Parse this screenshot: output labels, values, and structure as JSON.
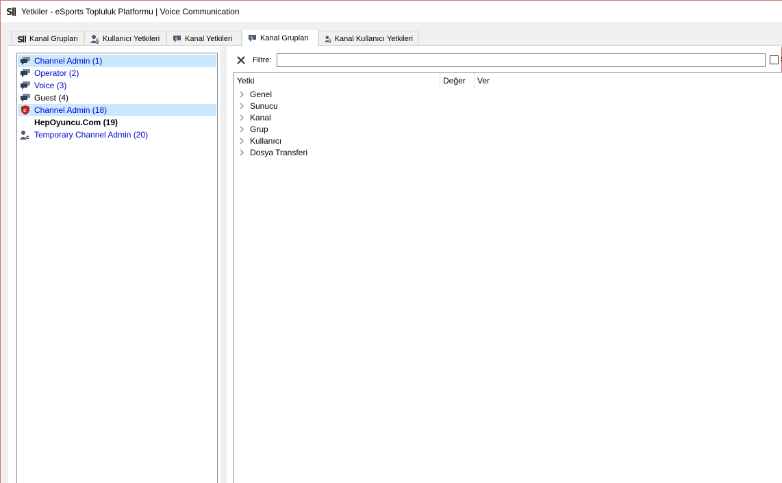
{
  "window": {
    "title": "Yetkiler - eSports Topluluk Platformu | Voice Communication",
    "icon": "permissions-app-icon"
  },
  "tabs": [
    {
      "label": "Kanal Grupları",
      "icon": "server-group-icon",
      "active": false
    },
    {
      "label": "Kullanıcı Yetkileri",
      "icon": "user-permissions-icon",
      "active": false
    },
    {
      "label": "Kanal Yetkileri",
      "icon": "channel-permissions-icon",
      "active": false
    },
    {
      "label": "Kanal Grupları",
      "icon": "channel-group-icon",
      "active": true
    },
    {
      "label": "Kanal Kullanıcı Yetkileri",
      "icon": "channel-client-permissions-icon",
      "active": false
    }
  ],
  "groups": [
    {
      "label": "Channel Admin (1)",
      "icon": "chat-bubbles-icon",
      "color": "#0000cc",
      "bold": false,
      "selected": true
    },
    {
      "label": "Operator (2)",
      "icon": "chat-bubbles-icon",
      "color": "#0000cc",
      "bold": false,
      "selected": false
    },
    {
      "label": "Voice (3)",
      "icon": "chat-bubbles-icon",
      "color": "#0000cc",
      "bold": false,
      "selected": false
    },
    {
      "label": "Guest (4)",
      "icon": "chat-bubbles-icon",
      "color": "#000000",
      "bold": false,
      "selected": false
    },
    {
      "label": "Channel Admin (18)",
      "icon": "red-shield-icon",
      "color": "#0000cc",
      "bold": false,
      "selected": true
    },
    {
      "label": "HepOyuncu.Com (19)",
      "icon": "",
      "color": "#000000",
      "bold": true,
      "selected": false
    },
    {
      "label": "Temporary Channel Admin (20)",
      "icon": "user-c-icon",
      "color": "#0000cc",
      "bold": false,
      "selected": false
    }
  ],
  "filter": {
    "label": "Filtre:",
    "value": "",
    "checkbox_label": "S",
    "clear_icon": "close-icon"
  },
  "permissions": {
    "columns": [
      "Yetki",
      "Değer",
      "Ver"
    ],
    "categories": [
      "Genel",
      "Sunucu",
      "Kanal",
      "Grup",
      "Kullanıcı",
      "Dosya Transferi"
    ]
  }
}
